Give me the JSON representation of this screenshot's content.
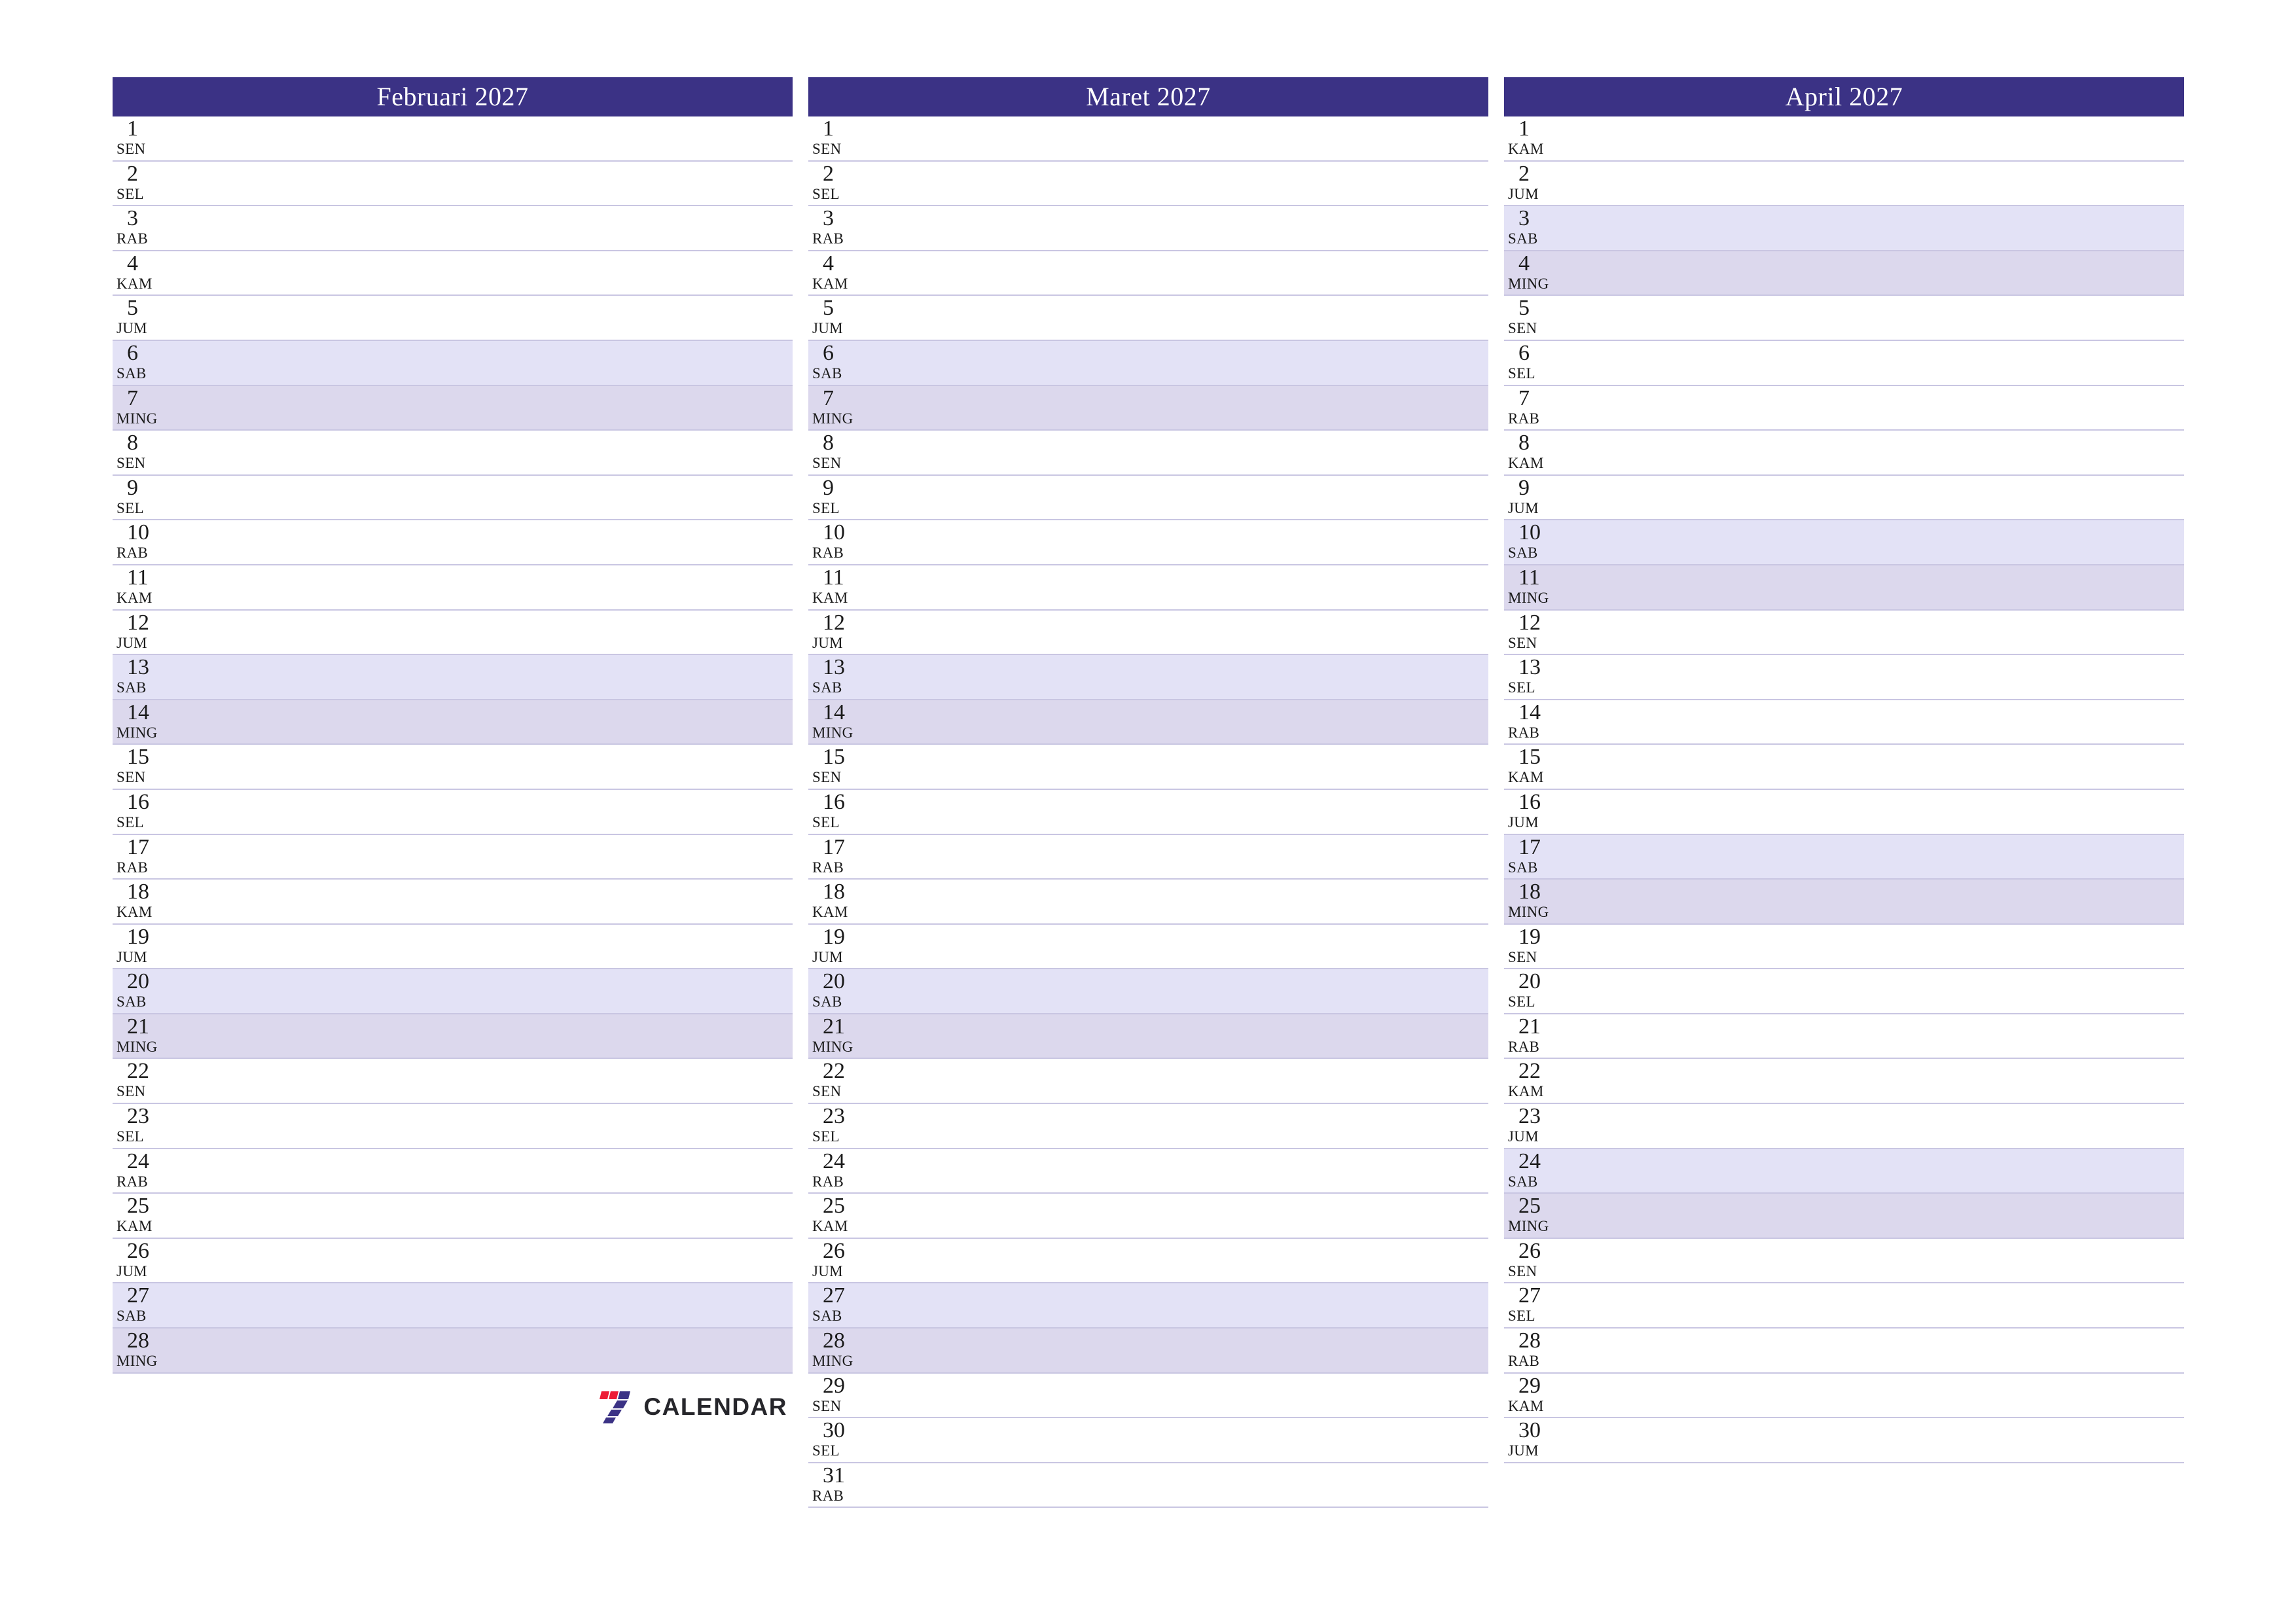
{
  "document": {
    "type": "printable-monthly-planner",
    "year": "2027",
    "language": "Indonesian"
  },
  "colors": {
    "header_bg": "#3b3285",
    "header_text": "#ffffff",
    "saturday_bg": "#e3e2f6",
    "sunday_bg": "#dcd8ed",
    "row_divider": "#c9c6e2",
    "page_bg": "#ffffff",
    "logo_red": "#ed1c35",
    "logo_purple": "#3b3285",
    "logo_text": "#26262b"
  },
  "brand": {
    "mark_name": "seven-logo-icon",
    "label": "CALENDAR"
  },
  "months": [
    {
      "id": "februari",
      "title": "Februari 2027",
      "days": [
        {
          "num": "1",
          "abbr": "SEN",
          "kind": "weekday"
        },
        {
          "num": "2",
          "abbr": "SEL",
          "kind": "weekday"
        },
        {
          "num": "3",
          "abbr": "RAB",
          "kind": "weekday"
        },
        {
          "num": "4",
          "abbr": "KAM",
          "kind": "weekday"
        },
        {
          "num": "5",
          "abbr": "JUM",
          "kind": "weekday"
        },
        {
          "num": "6",
          "abbr": "SAB",
          "kind": "sat"
        },
        {
          "num": "7",
          "abbr": "MING",
          "kind": "sun"
        },
        {
          "num": "8",
          "abbr": "SEN",
          "kind": "weekday"
        },
        {
          "num": "9",
          "abbr": "SEL",
          "kind": "weekday"
        },
        {
          "num": "10",
          "abbr": "RAB",
          "kind": "weekday"
        },
        {
          "num": "11",
          "abbr": "KAM",
          "kind": "weekday"
        },
        {
          "num": "12",
          "abbr": "JUM",
          "kind": "weekday"
        },
        {
          "num": "13",
          "abbr": "SAB",
          "kind": "sat"
        },
        {
          "num": "14",
          "abbr": "MING",
          "kind": "sun"
        },
        {
          "num": "15",
          "abbr": "SEN",
          "kind": "weekday"
        },
        {
          "num": "16",
          "abbr": "SEL",
          "kind": "weekday"
        },
        {
          "num": "17",
          "abbr": "RAB",
          "kind": "weekday"
        },
        {
          "num": "18",
          "abbr": "KAM",
          "kind": "weekday"
        },
        {
          "num": "19",
          "abbr": "JUM",
          "kind": "weekday"
        },
        {
          "num": "20",
          "abbr": "SAB",
          "kind": "sat"
        },
        {
          "num": "21",
          "abbr": "MING",
          "kind": "sun"
        },
        {
          "num": "22",
          "abbr": "SEN",
          "kind": "weekday"
        },
        {
          "num": "23",
          "abbr": "SEL",
          "kind": "weekday"
        },
        {
          "num": "24",
          "abbr": "RAB",
          "kind": "weekday"
        },
        {
          "num": "25",
          "abbr": "KAM",
          "kind": "weekday"
        },
        {
          "num": "26",
          "abbr": "JUM",
          "kind": "weekday"
        },
        {
          "num": "27",
          "abbr": "SAB",
          "kind": "sat"
        },
        {
          "num": "28",
          "abbr": "MING",
          "kind": "sun"
        }
      ],
      "has_brand": true
    },
    {
      "id": "maret",
      "title": "Maret 2027",
      "days": [
        {
          "num": "1",
          "abbr": "SEN",
          "kind": "weekday"
        },
        {
          "num": "2",
          "abbr": "SEL",
          "kind": "weekday"
        },
        {
          "num": "3",
          "abbr": "RAB",
          "kind": "weekday"
        },
        {
          "num": "4",
          "abbr": "KAM",
          "kind": "weekday"
        },
        {
          "num": "5",
          "abbr": "JUM",
          "kind": "weekday"
        },
        {
          "num": "6",
          "abbr": "SAB",
          "kind": "sat"
        },
        {
          "num": "7",
          "abbr": "MING",
          "kind": "sun"
        },
        {
          "num": "8",
          "abbr": "SEN",
          "kind": "weekday"
        },
        {
          "num": "9",
          "abbr": "SEL",
          "kind": "weekday"
        },
        {
          "num": "10",
          "abbr": "RAB",
          "kind": "weekday"
        },
        {
          "num": "11",
          "abbr": "KAM",
          "kind": "weekday"
        },
        {
          "num": "12",
          "abbr": "JUM",
          "kind": "weekday"
        },
        {
          "num": "13",
          "abbr": "SAB",
          "kind": "sat"
        },
        {
          "num": "14",
          "abbr": "MING",
          "kind": "sun"
        },
        {
          "num": "15",
          "abbr": "SEN",
          "kind": "weekday"
        },
        {
          "num": "16",
          "abbr": "SEL",
          "kind": "weekday"
        },
        {
          "num": "17",
          "abbr": "RAB",
          "kind": "weekday"
        },
        {
          "num": "18",
          "abbr": "KAM",
          "kind": "weekday"
        },
        {
          "num": "19",
          "abbr": "JUM",
          "kind": "weekday"
        },
        {
          "num": "20",
          "abbr": "SAB",
          "kind": "sat"
        },
        {
          "num": "21",
          "abbr": "MING",
          "kind": "sun"
        },
        {
          "num": "22",
          "abbr": "SEN",
          "kind": "weekday"
        },
        {
          "num": "23",
          "abbr": "SEL",
          "kind": "weekday"
        },
        {
          "num": "24",
          "abbr": "RAB",
          "kind": "weekday"
        },
        {
          "num": "25",
          "abbr": "KAM",
          "kind": "weekday"
        },
        {
          "num": "26",
          "abbr": "JUM",
          "kind": "weekday"
        },
        {
          "num": "27",
          "abbr": "SAB",
          "kind": "sat"
        },
        {
          "num": "28",
          "abbr": "MING",
          "kind": "sun"
        },
        {
          "num": "29",
          "abbr": "SEN",
          "kind": "weekday"
        },
        {
          "num": "30",
          "abbr": "SEL",
          "kind": "weekday"
        },
        {
          "num": "31",
          "abbr": "RAB",
          "kind": "weekday"
        }
      ],
      "has_brand": false
    },
    {
      "id": "april",
      "title": "April 2027",
      "days": [
        {
          "num": "1",
          "abbr": "KAM",
          "kind": "weekday"
        },
        {
          "num": "2",
          "abbr": "JUM",
          "kind": "weekday"
        },
        {
          "num": "3",
          "abbr": "SAB",
          "kind": "sat"
        },
        {
          "num": "4",
          "abbr": "MING",
          "kind": "sun"
        },
        {
          "num": "5",
          "abbr": "SEN",
          "kind": "weekday"
        },
        {
          "num": "6",
          "abbr": "SEL",
          "kind": "weekday"
        },
        {
          "num": "7",
          "abbr": "RAB",
          "kind": "weekday"
        },
        {
          "num": "8",
          "abbr": "KAM",
          "kind": "weekday"
        },
        {
          "num": "9",
          "abbr": "JUM",
          "kind": "weekday"
        },
        {
          "num": "10",
          "abbr": "SAB",
          "kind": "sat"
        },
        {
          "num": "11",
          "abbr": "MING",
          "kind": "sun"
        },
        {
          "num": "12",
          "abbr": "SEN",
          "kind": "weekday"
        },
        {
          "num": "13",
          "abbr": "SEL",
          "kind": "weekday"
        },
        {
          "num": "14",
          "abbr": "RAB",
          "kind": "weekday"
        },
        {
          "num": "15",
          "abbr": "KAM",
          "kind": "weekday"
        },
        {
          "num": "16",
          "abbr": "JUM",
          "kind": "weekday"
        },
        {
          "num": "17",
          "abbr": "SAB",
          "kind": "sat"
        },
        {
          "num": "18",
          "abbr": "MING",
          "kind": "sun"
        },
        {
          "num": "19",
          "abbr": "SEN",
          "kind": "weekday"
        },
        {
          "num": "20",
          "abbr": "SEL",
          "kind": "weekday"
        },
        {
          "num": "21",
          "abbr": "RAB",
          "kind": "weekday"
        },
        {
          "num": "22",
          "abbr": "KAM",
          "kind": "weekday"
        },
        {
          "num": "23",
          "abbr": "JUM",
          "kind": "weekday"
        },
        {
          "num": "24",
          "abbr": "SAB",
          "kind": "sat"
        },
        {
          "num": "25",
          "abbr": "MING",
          "kind": "sun"
        },
        {
          "num": "26",
          "abbr": "SEN",
          "kind": "weekday"
        },
        {
          "num": "27",
          "abbr": "SEL",
          "kind": "weekday"
        },
        {
          "num": "28",
          "abbr": "RAB",
          "kind": "weekday"
        },
        {
          "num": "29",
          "abbr": "KAM",
          "kind": "weekday"
        },
        {
          "num": "30",
          "abbr": "JUM",
          "kind": "weekday"
        }
      ],
      "has_brand": false
    }
  ]
}
